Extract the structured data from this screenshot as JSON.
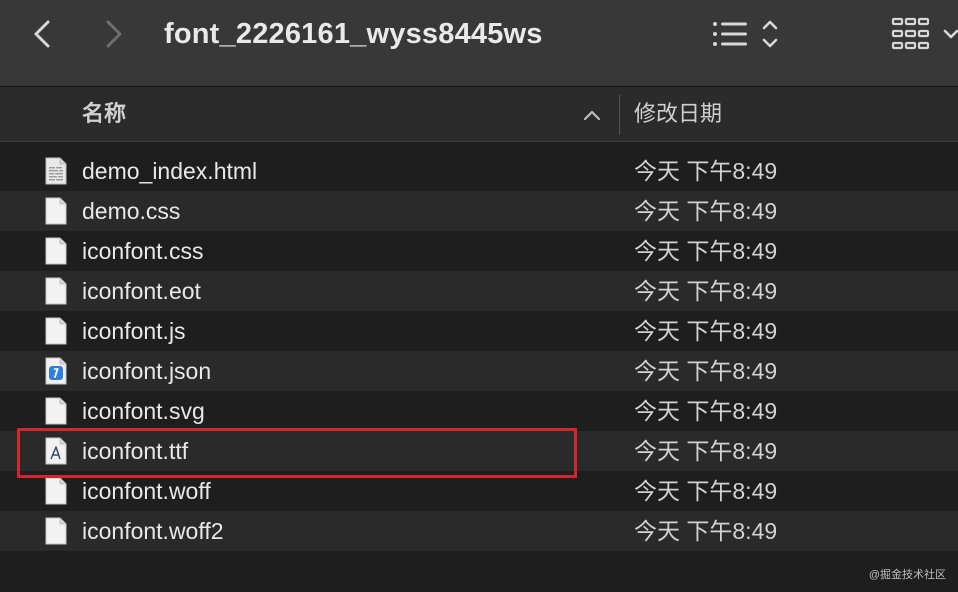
{
  "toolbar": {
    "title": "font_2226161_wyss8445ws",
    "back_icon": "chevron-left-icon",
    "forward_icon": "chevron-right-icon",
    "list_view_icon": "list-view-icon",
    "grid_view_icon": "icon-grid-view-icon"
  },
  "columns": {
    "name": "名称",
    "date_modified": "修改日期",
    "sort_icon": "chevron-up-icon"
  },
  "files": [
    {
      "name": "demo_index.html",
      "date": "今天 下午8:49",
      "icon": "html-file-icon"
    },
    {
      "name": "demo.css",
      "date": "今天 下午8:49",
      "icon": "document-file-icon"
    },
    {
      "name": "iconfont.css",
      "date": "今天 下午8:49",
      "icon": "document-file-icon"
    },
    {
      "name": "iconfont.eot",
      "date": "今天 下午8:49",
      "icon": "document-file-icon"
    },
    {
      "name": "iconfont.js",
      "date": "今天 下午8:49",
      "icon": "document-file-icon"
    },
    {
      "name": "iconfont.json",
      "date": "今天 下午8:49",
      "icon": "json-file-icon"
    },
    {
      "name": "iconfont.svg",
      "date": "今天 下午8:49",
      "icon": "document-file-icon"
    },
    {
      "name": "iconfont.ttf",
      "date": "今天 下午8:49",
      "icon": "font-file-icon",
      "highlighted": true
    },
    {
      "name": "iconfont.woff",
      "date": "今天 下午8:49",
      "icon": "document-file-icon"
    },
    {
      "name": "iconfont.woff2",
      "date": "今天 下午8:49",
      "icon": "document-file-icon"
    }
  ],
  "colors": {
    "highlight": "#d1262d",
    "json_badge": "#2f7fe0"
  },
  "watermark": "@掘金技术社区"
}
